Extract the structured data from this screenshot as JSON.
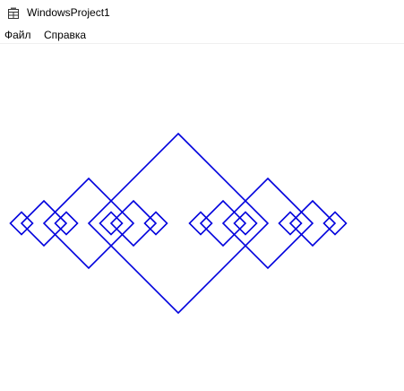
{
  "window": {
    "title": "WindowsProject1",
    "icon": "app-window-icon"
  },
  "menu": {
    "items": [
      {
        "label": "Файл"
      },
      {
        "label": "Справка"
      }
    ]
  },
  "drawing": {
    "stroke_color": "#0000dd",
    "shape": "diamond",
    "description_levels": 3
  }
}
